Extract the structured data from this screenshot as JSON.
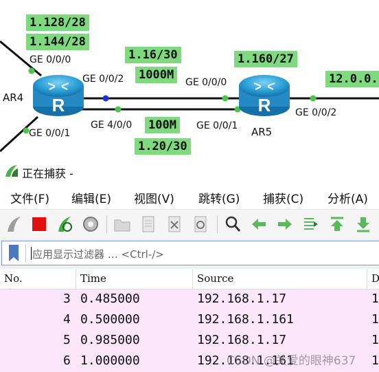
{
  "topology": {
    "labels": {
      "ip_1128": "1.128/28",
      "ip_1144": "1.144/28",
      "ip_116": "1.16/30",
      "ip_1000m": "1000M",
      "ip_1160": "1.160/27",
      "ip_12": "12.0.0.",
      "ip_100m": "100M",
      "ip_120": "1.20/30"
    },
    "ports": {
      "ar4_ge000": "GE 0/0/0",
      "ar4_ge002": "GE 0/0/2",
      "ar4_ge001": "GE 0/0/1",
      "ar4_ge400": "GE 4/0/0",
      "ar5_ge000": "GE 0/0/0",
      "ar5_ge001": "GE 0/0/1",
      "ar5_ge002": "GE 0/0/2"
    },
    "devices": {
      "ar4": "AR4",
      "ar5": "AR5"
    }
  },
  "window": {
    "title": "正在捕获 -"
  },
  "menu": [
    "文件(F)",
    "编辑(E)",
    "视图(V)",
    "跳转(G)",
    "捕获(C)",
    "分析(A)"
  ],
  "toolbar": [
    "shark-fin-icon",
    "stop-icon",
    "restart-icon",
    "options-icon",
    "open-folder-icon",
    "file-icon",
    "close-file-icon",
    "reload-icon",
    "search-icon",
    "back-arrow-icon",
    "forward-arrow-icon",
    "goto-packet-icon",
    "first-packet-icon",
    "last-packet-icon"
  ],
  "filter": {
    "placeholder": "应用显示过滤器 … <Ctrl-/>"
  },
  "packets": {
    "columns": [
      "No.",
      "Time",
      "Source",
      "De"
    ],
    "rows": [
      {
        "no": "3",
        "time": "0.485000",
        "source": "192.168.1.17",
        "dest": "1"
      },
      {
        "no": "4",
        "time": "0.500000",
        "source": "192.168.1.161",
        "dest": "1"
      },
      {
        "no": "5",
        "time": "0.985000",
        "source": "192.168.1.17",
        "dest": "1"
      },
      {
        "no": "6",
        "time": "1.000000",
        "source": "192.168.1.161",
        "dest": "1"
      }
    ]
  },
  "watermark": "CSDN @关爱的眼神637",
  "colors": {
    "label_green": "#7fd97f",
    "row_pink": "#fbe6fb",
    "router_blue": "#2a9fd6"
  }
}
